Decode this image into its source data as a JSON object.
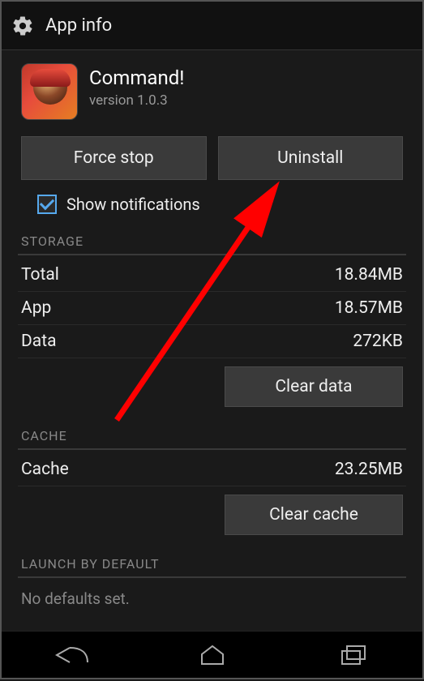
{
  "header": {
    "title": "App info"
  },
  "app": {
    "name": "Command!",
    "version": "version 1.0.3"
  },
  "buttons": {
    "force_stop": "Force stop",
    "uninstall": "Uninstall"
  },
  "notifications": {
    "label": "Show notifications",
    "checked": true
  },
  "storage": {
    "title": "STORAGE",
    "rows": [
      {
        "label": "Total",
        "value": "18.84MB"
      },
      {
        "label": "App",
        "value": "18.57MB"
      },
      {
        "label": "Data",
        "value": "272KB"
      }
    ],
    "clear_label": "Clear data"
  },
  "cache": {
    "title": "CACHE",
    "rows": [
      {
        "label": "Cache",
        "value": "23.25MB"
      }
    ],
    "clear_label": "Clear cache"
  },
  "launch": {
    "title": "LAUNCH BY DEFAULT",
    "no_defaults": "No defaults set."
  }
}
